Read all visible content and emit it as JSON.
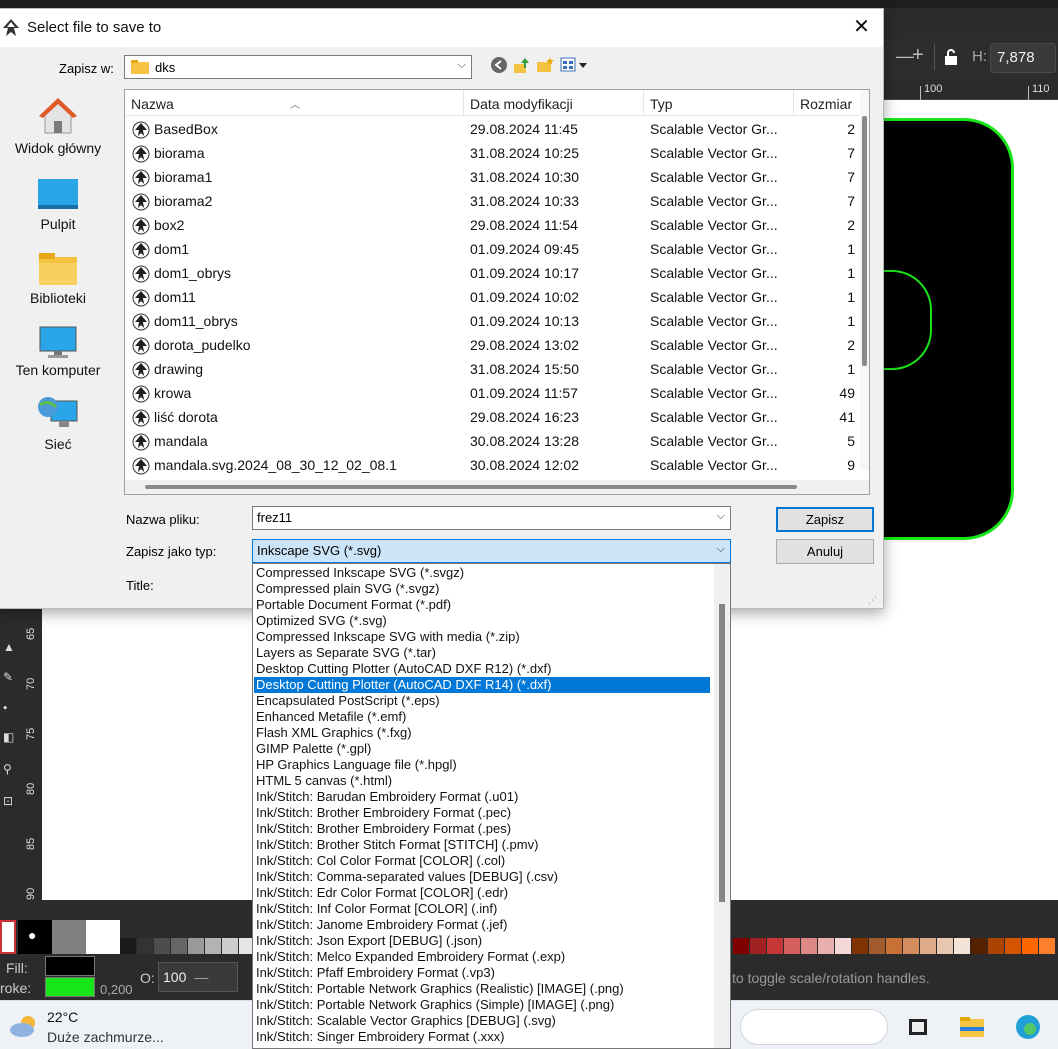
{
  "dialog": {
    "title": "Select file to save to",
    "close_label": "✕",
    "save_in_label": "Zapisz w:",
    "save_in_value": "dks",
    "places": [
      {
        "label": "Widok główny",
        "icon": "home-icon"
      },
      {
        "label": "Pulpit",
        "icon": "desktop-icon"
      },
      {
        "label": "Biblioteki",
        "icon": "libraries-icon"
      },
      {
        "label": "Ten komputer",
        "icon": "computer-icon"
      },
      {
        "label": "Sieć",
        "icon": "network-icon"
      }
    ],
    "columns": [
      "Nazwa",
      "Data modyfikacji",
      "Typ",
      "Rozmiar"
    ],
    "files": [
      {
        "name": "BasedBox",
        "date": "29.08.2024 11:45",
        "type": "Scalable Vector Gr...",
        "size": "2"
      },
      {
        "name": "biorama",
        "date": "31.08.2024 10:25",
        "type": "Scalable Vector Gr...",
        "size": "7"
      },
      {
        "name": "biorama1",
        "date": "31.08.2024 10:30",
        "type": "Scalable Vector Gr...",
        "size": "7"
      },
      {
        "name": "biorama2",
        "date": "31.08.2024 10:33",
        "type": "Scalable Vector Gr...",
        "size": "7"
      },
      {
        "name": "box2",
        "date": "29.08.2024 11:54",
        "type": "Scalable Vector Gr...",
        "size": "2"
      },
      {
        "name": "dom1",
        "date": "01.09.2024 09:45",
        "type": "Scalable Vector Gr...",
        "size": "1"
      },
      {
        "name": "dom1_obrys",
        "date": "01.09.2024 10:17",
        "type": "Scalable Vector Gr...",
        "size": "1"
      },
      {
        "name": "dom11",
        "date": "01.09.2024 10:02",
        "type": "Scalable Vector Gr...",
        "size": "1"
      },
      {
        "name": "dom11_obrys",
        "date": "01.09.2024 10:13",
        "type": "Scalable Vector Gr...",
        "size": "1"
      },
      {
        "name": "dorota_pudelko",
        "date": "29.08.2024 13:02",
        "type": "Scalable Vector Gr...",
        "size": "2"
      },
      {
        "name": "drawing",
        "date": "31.08.2024 15:50",
        "type": "Scalable Vector Gr...",
        "size": "1"
      },
      {
        "name": "krowa",
        "date": "01.09.2024 11:57",
        "type": "Scalable Vector Gr...",
        "size": "49"
      },
      {
        "name": "liść dorota",
        "date": "29.08.2024 16:23",
        "type": "Scalable Vector Gr...",
        "size": "41"
      },
      {
        "name": "mandala",
        "date": "30.08.2024 13:28",
        "type": "Scalable Vector Gr...",
        "size": "5"
      },
      {
        "name": "mandala.svg.2024_08_30_12_02_08.1",
        "date": "30.08.2024 12:02",
        "type": "Scalable Vector Gr...",
        "size": "9"
      }
    ],
    "filename_label": "Nazwa pliku:",
    "filename_value": "frez11",
    "save_as_type_label": "Zapisz jako typ:",
    "save_as_type_value": "Inkscape SVG (*.svg)",
    "title_label": "Title:",
    "save_button": "Zapisz",
    "cancel_button": "Anuluj",
    "type_options": [
      "Compressed Inkscape SVG (*.svgz)",
      "Compressed plain SVG (*.svgz)",
      "Portable Document Format (*.pdf)",
      "Optimized SVG (*.svg)",
      "Compressed Inkscape SVG with media (*.zip)",
      "Layers as Separate SVG (*.tar)",
      "Desktop Cutting Plotter (AutoCAD DXF R12) (*.dxf)",
      "Desktop Cutting Plotter (AutoCAD DXF R14) (*.dxf)",
      "Encapsulated PostScript (*.eps)",
      "Enhanced Metafile (*.emf)",
      "Flash XML Graphics (*.fxg)",
      "GIMP Palette (*.gpl)",
      "HP Graphics Language file (*.hpgl)",
      "HTML 5 canvas (*.html)",
      "Ink/Stitch: Barudan Embroidery Format (.u01)",
      "Ink/Stitch: Brother Embroidery Format (.pec)",
      "Ink/Stitch: Brother Embroidery Format (.pes)",
      "Ink/Stitch: Brother Stitch Format [STITCH] (.pmv)",
      "Ink/Stitch: Col Color Format [COLOR] (.col)",
      "Ink/Stitch: Comma-separated values [DEBUG] (.csv)",
      "Ink/Stitch: Edr Color Format [COLOR] (.edr)",
      "Ink/Stitch: Inf Color Format [COLOR] (.inf)",
      "Ink/Stitch: Janome Embroidery Format (.jef)",
      "Ink/Stitch: Json Export [DEBUG] (.json)",
      "Ink/Stitch: Melco Expanded Embroidery Format (.exp)",
      "Ink/Stitch: Pfaff Embroidery Format (.vp3)",
      "Ink/Stitch: Portable Network Graphics (Realistic) [IMAGE] (.png)",
      "Ink/Stitch: Portable Network Graphics (Simple) [IMAGE] (.png)",
      "Ink/Stitch: Scalable Vector Graphics [DEBUG] (.svg)",
      "Ink/Stitch: Singer Embroidery Format (.xxx)"
    ],
    "selected_type_index": 7
  },
  "inkscape": {
    "h_label": "H:",
    "h_value": "7,878",
    "ruler_top": [
      "100",
      "110"
    ],
    "ruler_left": [
      "65",
      "70",
      "75",
      "80",
      "85",
      "90"
    ],
    "fill_label": "Fill:",
    "stroke_label": "roke:",
    "stroke_width": "0,200",
    "opacity_label": "O:",
    "opacity_value": "100",
    "status_message": "to toggle scale/rotation handles.",
    "fill_color": "#000000",
    "stroke_color": "#19e619"
  },
  "taskbar": {
    "temperature": "22°C",
    "condition": "Duże zachmurze..."
  }
}
